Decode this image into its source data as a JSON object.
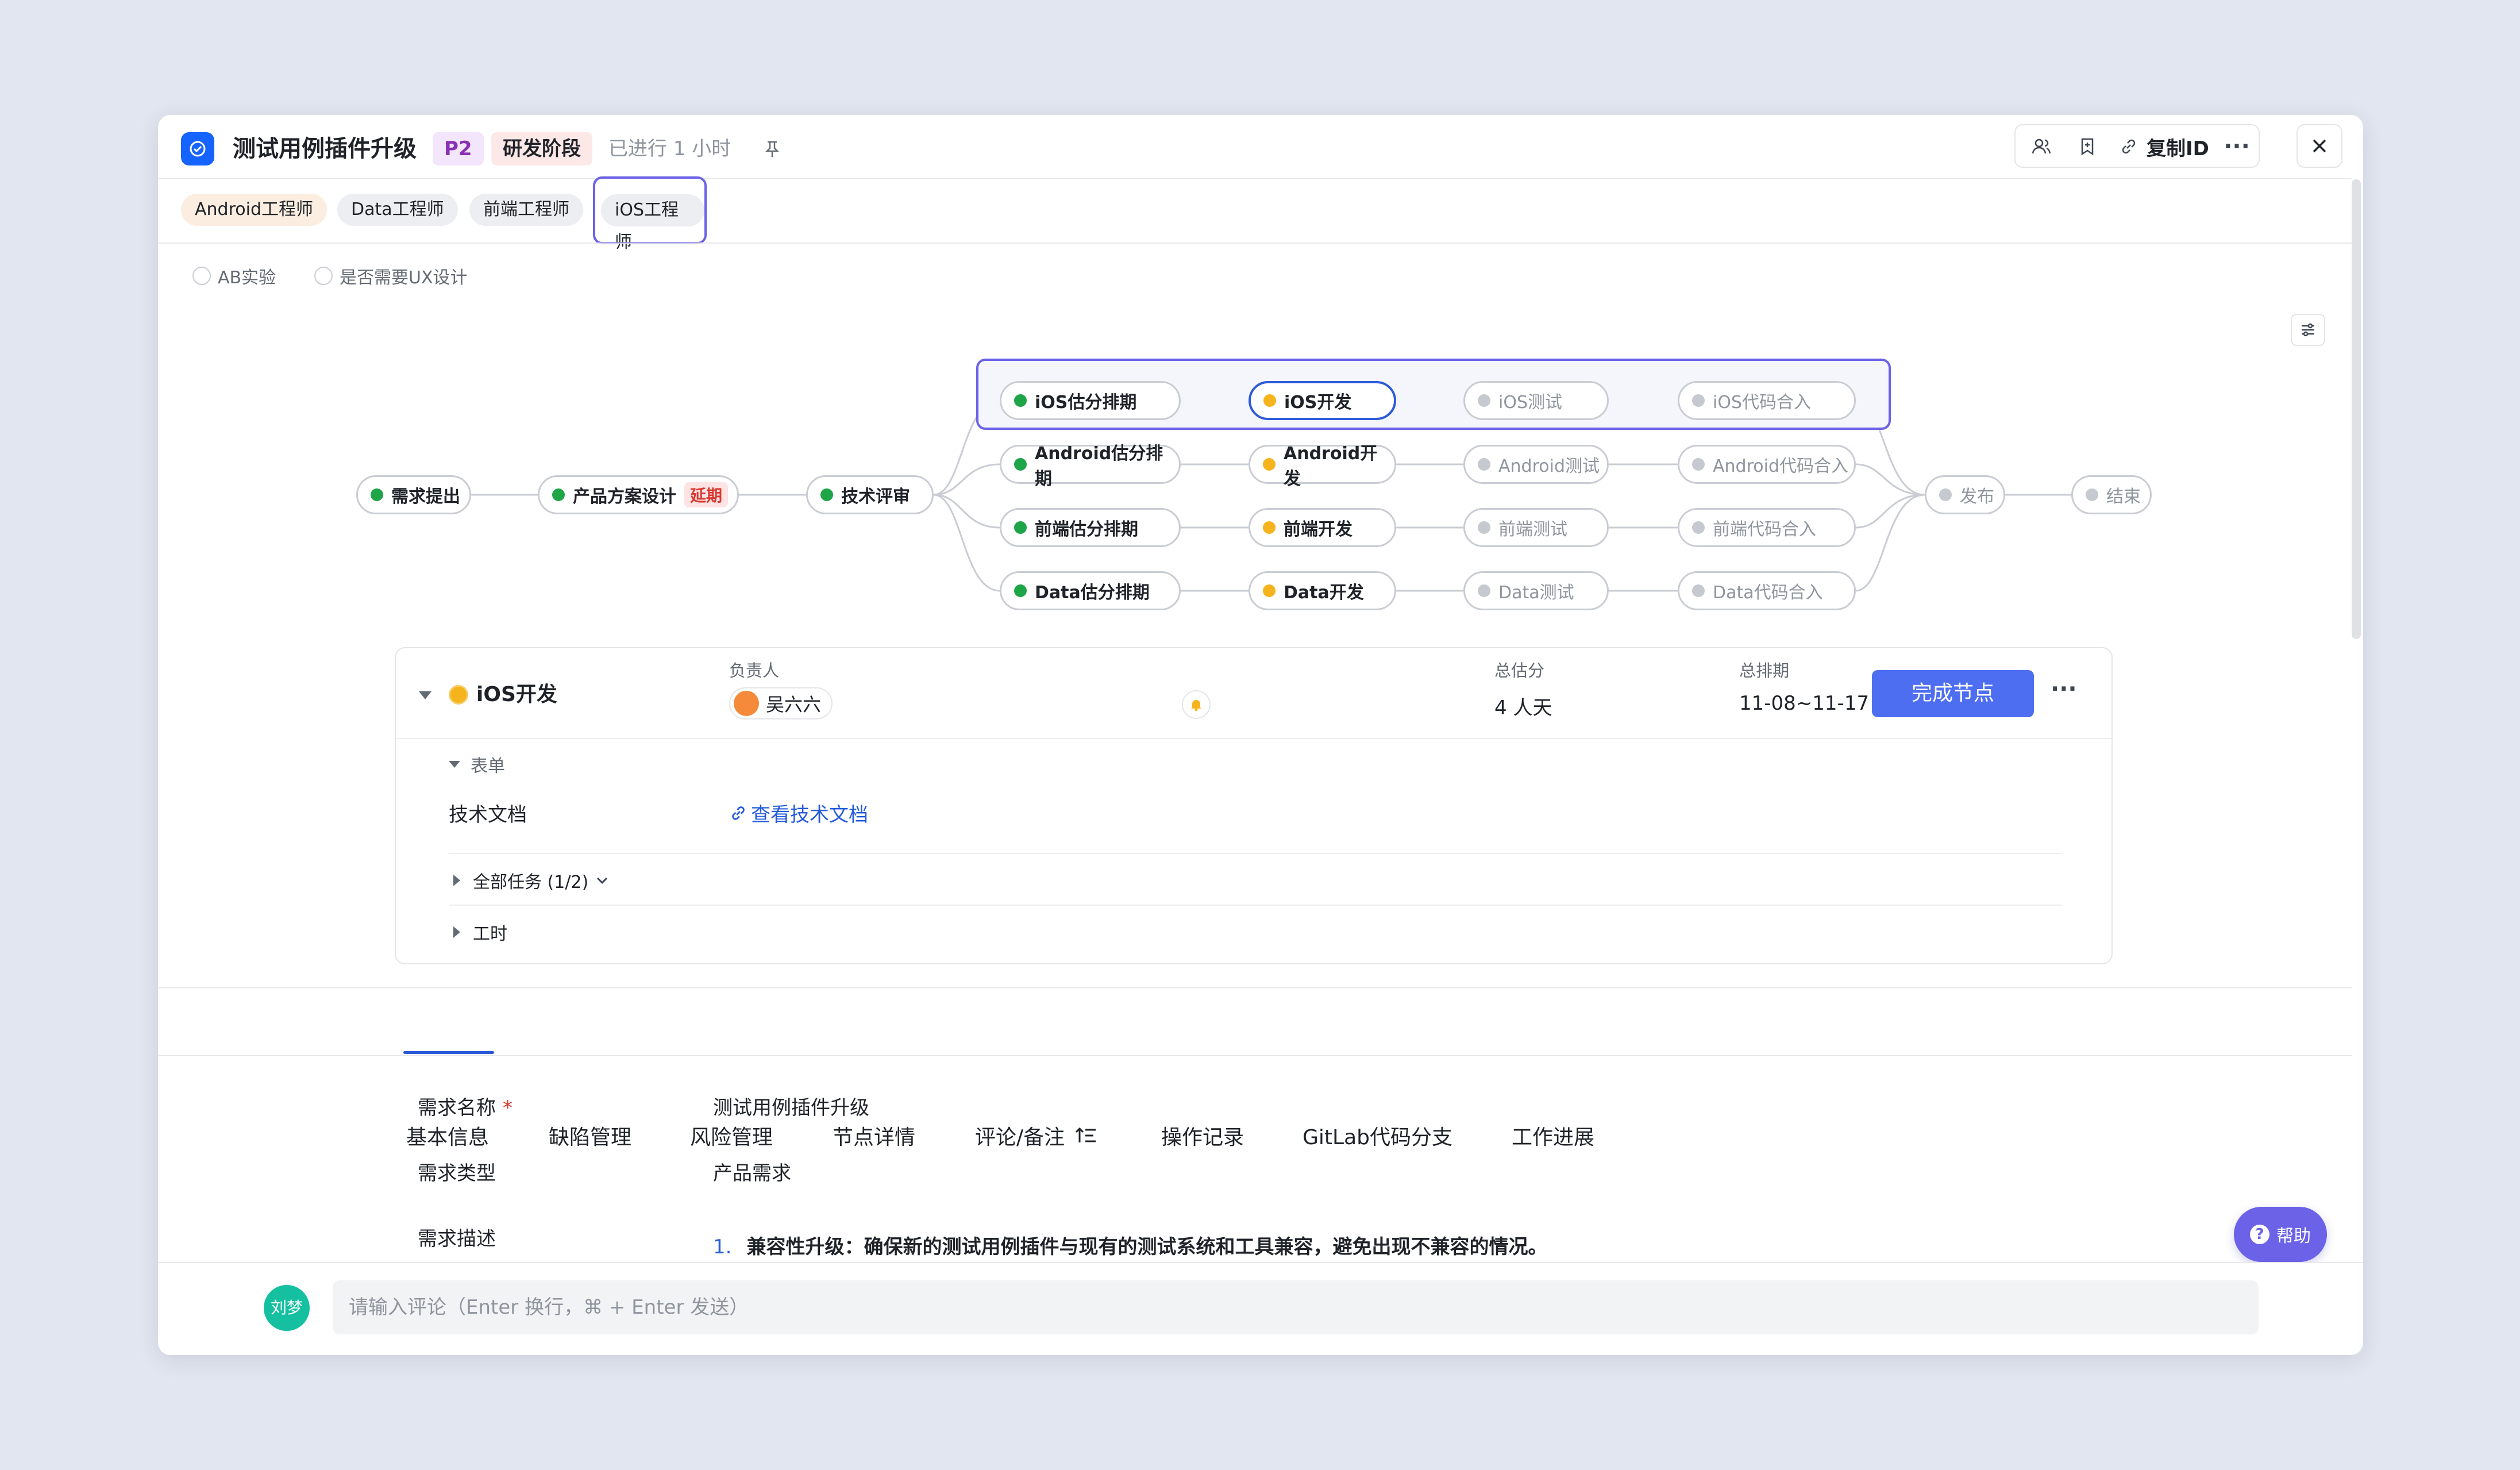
{
  "header": {
    "title": "测试用例插件升级",
    "priority": "P2",
    "stage": "研发阶段",
    "elapsed": "已进行 1 小时",
    "copy_id_label": "复制ID"
  },
  "roles": [
    "Android工程师",
    "Data工程师",
    "前端工程师",
    "iOS工程师"
  ],
  "options": [
    "AB实验",
    "是否需要UX设计"
  ],
  "flow": {
    "main": [
      {
        "label": "需求提出",
        "status": "done"
      },
      {
        "label": "产品方案设计",
        "status": "done",
        "badge": "延期"
      },
      {
        "label": "技术评审",
        "status": "done"
      }
    ],
    "rows": [
      [
        "iOS估分排期",
        "iOS开发",
        "iOS测试",
        "iOS代码合入"
      ],
      [
        "Android估分排期",
        "Android开发",
        "Android测试",
        "Android代码合入"
      ],
      [
        "前端估分排期",
        "前端开发",
        "前端测试",
        "前端代码合入"
      ],
      [
        "Data估分排期",
        "Data开发",
        "Data测试",
        "Data代码合入"
      ]
    ],
    "end": [
      "发布",
      "结束"
    ]
  },
  "detail": {
    "node_name": "iOS开发",
    "owner_label": "负责人",
    "owner": "吴六六",
    "estimate_label": "总估分",
    "estimate": "4 人天",
    "schedule_label": "总排期",
    "schedule": "11-08~11-17",
    "complete_button": "完成节点",
    "form_label": "表单",
    "tech_doc_label": "技术文档",
    "tech_doc_link": "查看技术文档",
    "tasks_label": "全部任务 (1/2)",
    "worktime_label": "工时"
  },
  "tabs": [
    "基本信息",
    "缺陷管理",
    "风险管理",
    "节点详情",
    "评论/备注",
    "操作记录",
    "GitLab代码分支",
    "工作进展"
  ],
  "basic": {
    "name_label": "需求名称",
    "name_value": "测试用例插件升级",
    "type_label": "需求类型",
    "type_value": "产品需求",
    "desc_label": "需求描述",
    "desc_index": "1.",
    "desc_value": "兼容性升级：确保新的测试用例插件与现有的测试系统和工具兼容，避免出现不兼容的情况。"
  },
  "comment": {
    "user": "刘梦",
    "placeholder": "请输入评论（Enter 换行，⌘ + Enter 发送）"
  },
  "help_label": "帮助",
  "colors": {
    "accent": "#4e6ef2",
    "done": "#1ea548",
    "doing": "#f5b41d"
  }
}
